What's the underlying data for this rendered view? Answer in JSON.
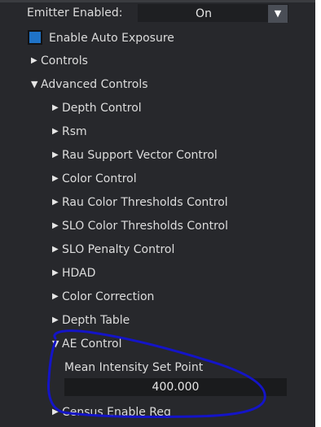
{
  "emitter": {
    "label": "Emitter Enabled:",
    "value": "On"
  },
  "auto_exposure": {
    "label": "Enable Auto Exposure",
    "checked": true,
    "accent_color": "#1f73c7"
  },
  "tree": {
    "controls": "Controls",
    "advanced_controls": "Advanced Controls",
    "items": [
      "Depth Control",
      "Rsm",
      "Rau Support Vector Control",
      "Color Control",
      "Rau Color Thresholds Control",
      "SLO Color Thresholds Control",
      "SLO Penalty Control",
      "HDAD",
      "Color Correction",
      "Depth Table"
    ],
    "ae_control": "AE Control",
    "census": "Census Enable Reg"
  },
  "ae": {
    "field_label": "Mean Intensity Set Point",
    "field_value": "400.000"
  },
  "annotation_color": "#1414c8"
}
